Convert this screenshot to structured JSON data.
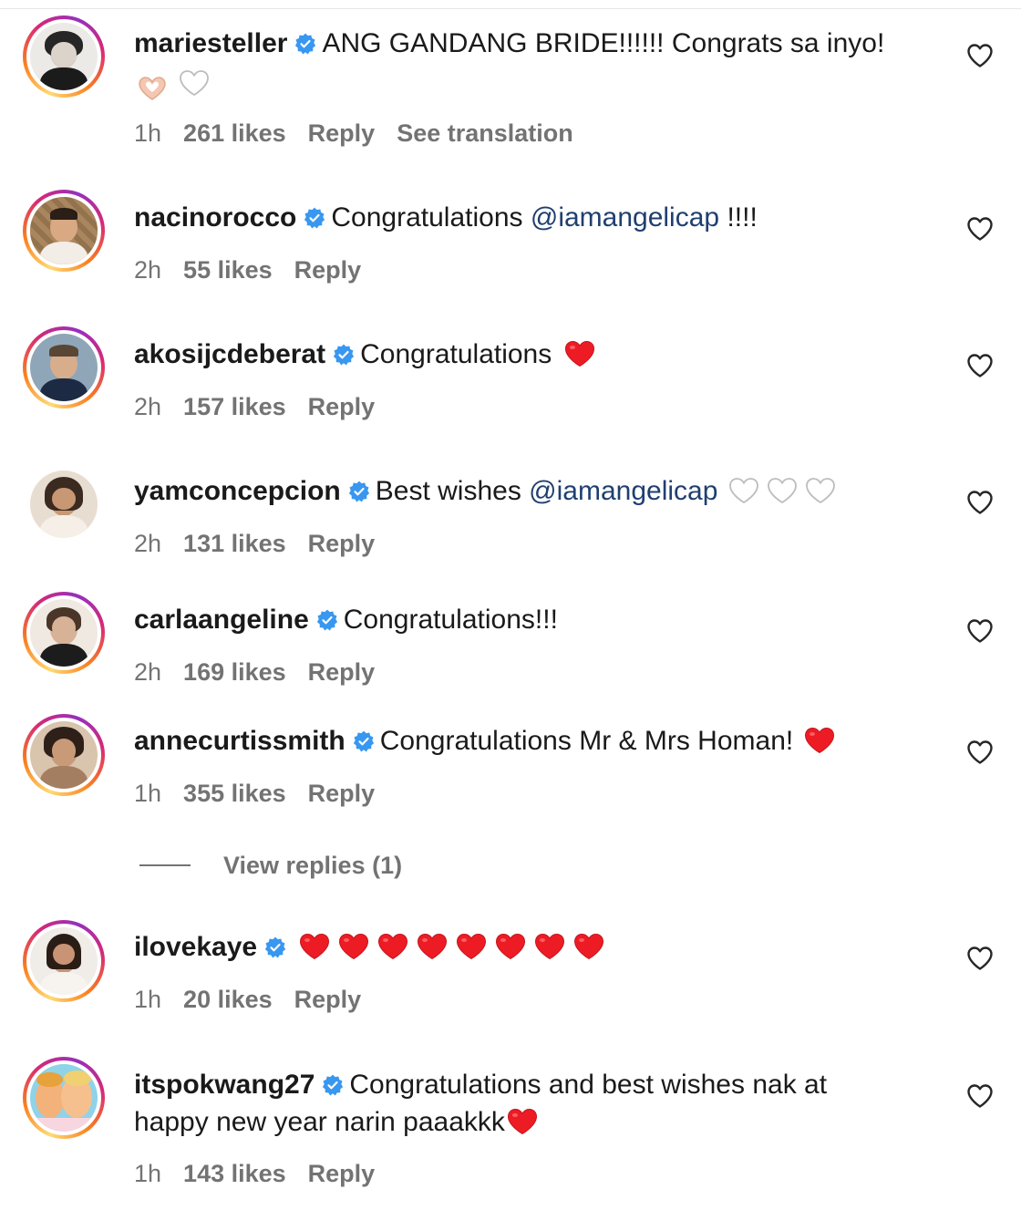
{
  "colors": {
    "verified": "#3897f0",
    "red_heart": "#ed1c24",
    "meta_text": "#737373",
    "mention": "#1f3f70"
  },
  "comments": [
    {
      "username": "mariesteller",
      "text": "ANG GANDANG BRIDE!!!!!! Congrats sa inyo!",
      "time": "1h",
      "likes": "261 likes",
      "reply": "Reply",
      "translate": "See translation"
    },
    {
      "username": "nacinorocco",
      "text": "Congratulations",
      "mention": "@iamangelicap",
      "text_after": "!!!!",
      "time": "2h",
      "likes": "55 likes",
      "reply": "Reply"
    },
    {
      "username": "akosijcdeberat",
      "text": "Congratulations",
      "time": "2h",
      "likes": "157 likes",
      "reply": "Reply"
    },
    {
      "username": "yamconcepcion",
      "text": "Best wishes",
      "mention": "@iamangelicap",
      "time": "2h",
      "likes": "131 likes",
      "reply": "Reply"
    },
    {
      "username": "carlaangeline",
      "text": "Congratulations!!!",
      "time": "2h",
      "likes": "169 likes",
      "reply": "Reply"
    },
    {
      "username": "annecurtissmith",
      "text": "Congratulations Mr & Mrs Homan!",
      "time": "1h",
      "likes": "355 likes",
      "reply": "Reply"
    },
    {
      "username": "ilovekaye",
      "text": "",
      "time": "1h",
      "likes": "20 likes",
      "reply": "Reply"
    },
    {
      "username": "itspokwang27",
      "text": "Congratulations and best wishes nak at",
      "text_line2": "happy new year narin paaakkk",
      "time": "1h",
      "likes": "143 likes",
      "reply": "Reply"
    }
  ],
  "view_replies": "View replies (1)"
}
